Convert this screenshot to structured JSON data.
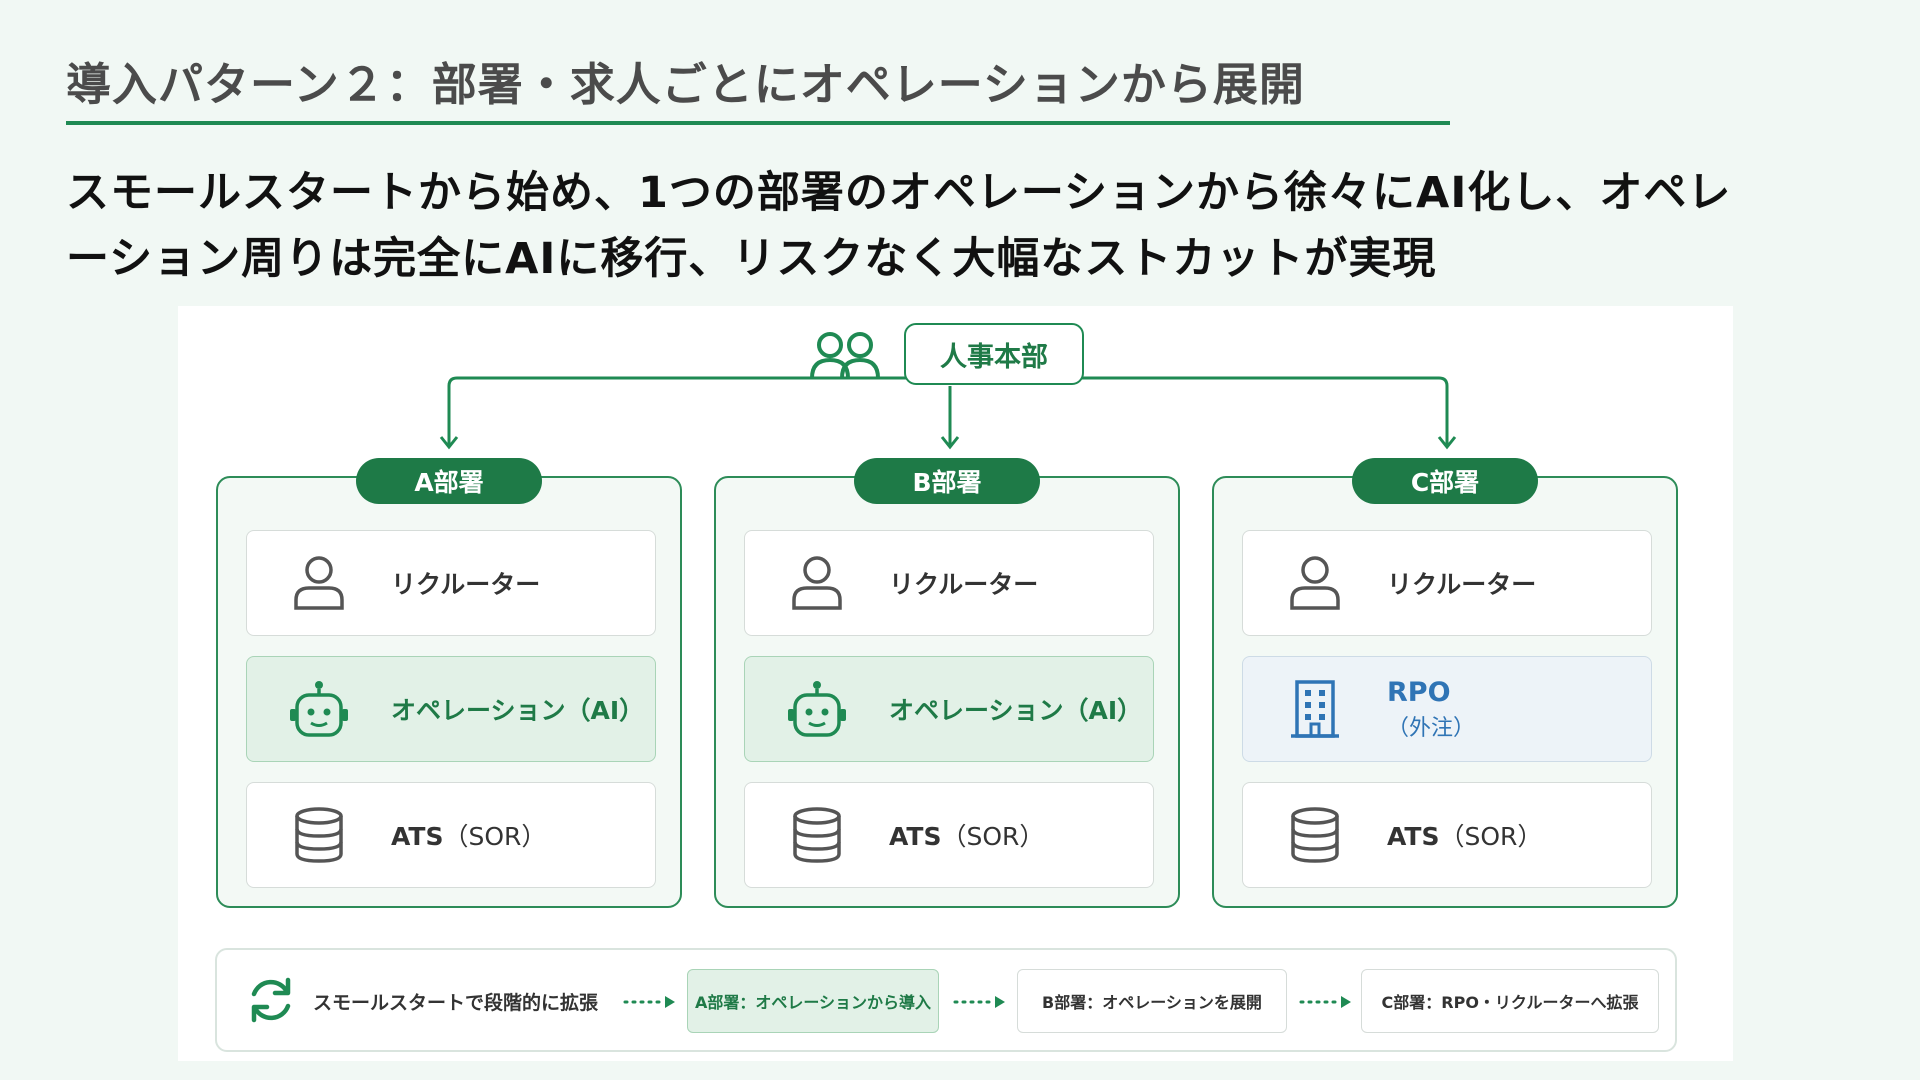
{
  "title": "導入パターン２：部署・求人ごとにオペレーションから展開",
  "lead": {
    "line1": "スモールスタートから始め、1つの部署のオペレーションから徐々にAI化し、オペレ",
    "line2": "ーション周りは完全にAIに移行、リスクなく大幅なストカットが実現"
  },
  "diagram": {
    "hq_label": "人事本部",
    "departments": [
      {
        "name": "A部署",
        "recruiter": "リクルーター",
        "operation": "オペレーション（AI）",
        "ats_main": "ATS",
        "ats_sub": "（SOR）"
      },
      {
        "name": "B部署",
        "recruiter": "リクルーター",
        "operation": "オペレーション（AI）",
        "ats_main": "ATS",
        "ats_sub": "（SOR）"
      },
      {
        "name": "C部署",
        "recruiter": "リクルーター",
        "rpo_main": "RPO",
        "rpo_sub": "（外注）",
        "ats_main": "ATS",
        "ats_sub": "（SOR）"
      }
    ],
    "rollout": {
      "label": "スモールスタートで段階的に拡張",
      "steps": [
        "A部署：オペレーションから導入",
        "B部署：オペレーションを展開",
        "C部署：RPO・リクルーターへ拡張"
      ]
    }
  },
  "colors": {
    "accent_green": "#1e7a47",
    "light_green": "#e2f1e7",
    "rpo_blue": "#2f74b5",
    "background": "#f1f8f4"
  },
  "icons": [
    "people-icon",
    "person-icon",
    "robot-icon",
    "building-icon",
    "database-icon",
    "refresh-icon",
    "dotted-arrow-icon"
  ]
}
